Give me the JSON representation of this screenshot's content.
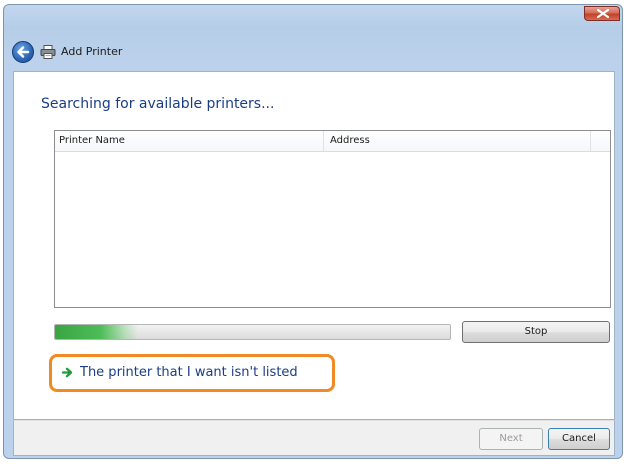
{
  "window": {
    "title": "Add Printer",
    "close_icon": "close-icon",
    "back_icon": "back-arrow-icon",
    "title_icon": "printer-icon"
  },
  "main": {
    "heading": "Searching for available printers...",
    "list": {
      "columns": [
        "Printer Name",
        "Address"
      ],
      "rows": []
    },
    "progress": {
      "fraction": 0.21,
      "color": "#4dbd57"
    },
    "stop_label": "Stop",
    "link": {
      "icon": "green-arrow-icon",
      "text": "The printer that I want isn't listed",
      "highlight_color": "#f08a24"
    }
  },
  "footer": {
    "next_label": "Next",
    "cancel_label": "Cancel"
  }
}
